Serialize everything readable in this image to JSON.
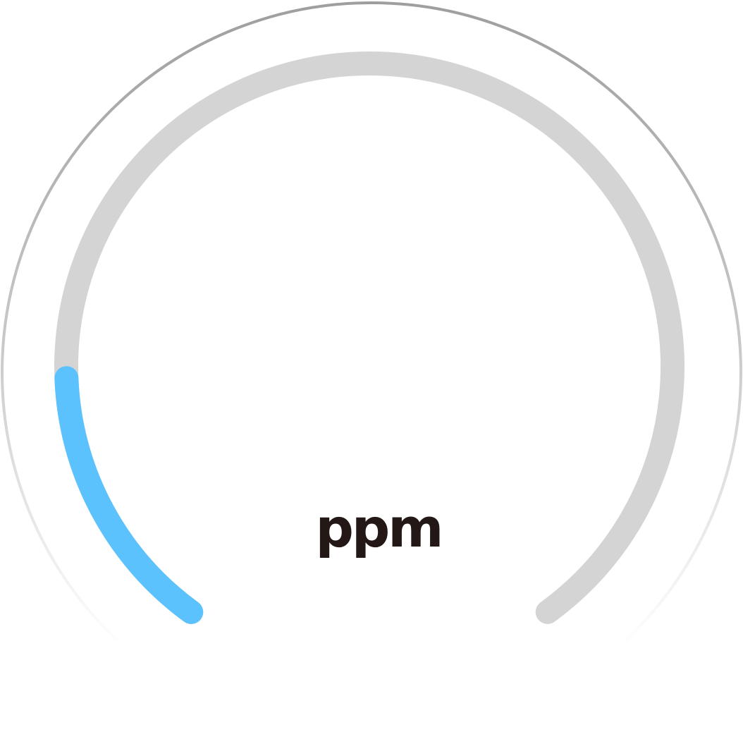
{
  "gauge": {
    "unit": "ppm",
    "level": 0.18,
    "colors": {
      "outer_ring": "#9e9e9e",
      "track": "#d4d4d4",
      "fill": "#5bc2fd",
      "unit_text": "#231815",
      "background": "#ffffff"
    }
  }
}
